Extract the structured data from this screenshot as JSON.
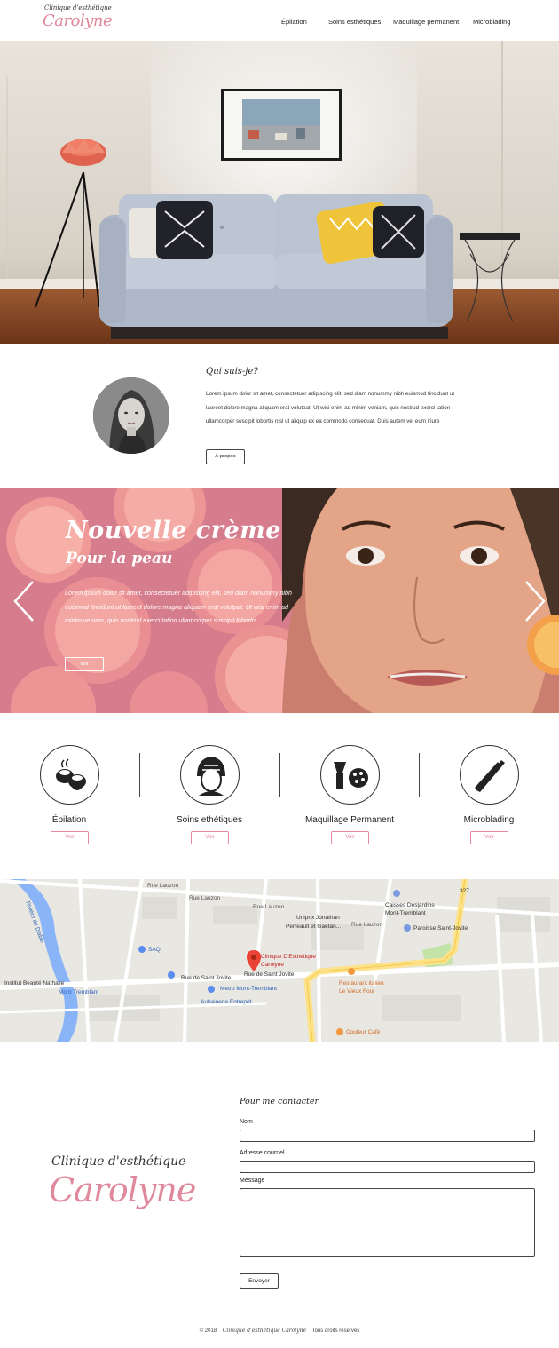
{
  "logo": {
    "line1": "Clinique d'esthétique",
    "line2": "Carolyne"
  },
  "nav": {
    "items": [
      {
        "label": "Épilation"
      },
      {
        "label": "Soins esthétiques"
      },
      {
        "label": "Maquillage permanent"
      },
      {
        "label": "Microblading"
      }
    ]
  },
  "about": {
    "title": "Qui suis-je?",
    "text": "Lorem ipsum dolor sit amet, consectetuer adipiscing elit, sed diam nonummy nibh euismod tincidunt ut laoreet dolore magna aliquam erat volutpat. Ut wisi enim ad minim veniam, quis nostrud exerci tation ullamcorper suscipit lobortis nisl ut aliquip ex ea commodo consequat. Duis autem vel eum iriure",
    "button": "À propos"
  },
  "promo": {
    "title": "Nouvelle crème",
    "subtitle": "Pour la peau",
    "text": "Lorem ipsum dolor sit amet, consectetuer adipiscing elit, sed diam nonummy nibh euismod tincidunt ut laoreet dolore magna aliquam erat volutpat. Ut wisi enim ad minim veniam, quis nostrud exerci tation ullamcorper suscipit lobortis",
    "button": "Voir"
  },
  "services": [
    {
      "name": "Épilation",
      "button": "Voir",
      "icon": "hot-stones-icon"
    },
    {
      "name": "Soins ethétiques",
      "button": "Voir",
      "icon": "face-towel-icon"
    },
    {
      "name": "Maquillage Permanent",
      "button": "Voir",
      "icon": "makeup-brush-palette-icon"
    },
    {
      "name": "Microblading",
      "button": "Voir",
      "icon": "tweezers-icon"
    }
  ],
  "map": {
    "labels": {
      "clinic_line1": "Clinique D'Esthétique",
      "clinic_line2": "Carolyne",
      "rue_saint_jovite": "Rue de Saint Jovite",
      "rue_saint_jovite_2": "Rue de Saint Jovite",
      "rue_lauzon_1": "Rue Lauzon",
      "rue_lauzon_2": "Rue Lauzon",
      "rue_lauzon_3": "Rue Lauzon",
      "rue_lauzon_4": "Rue Lauzon",
      "uniprix_1": "Uniprix Jonathan",
      "uniprix_2": "Perreault et Gaëtan...",
      "caisses_1": "Caisses Desjardins",
      "caisses_2": "Mont-Tremblant",
      "paroisse": "Paroisse Saint-Jovite",
      "saq": "SAQ",
      "institut": "Institut Beauté Nathalie",
      "mont_tremblant": "Mont Tremblant",
      "metro": "Metro Mont-Tremblant",
      "aubainerie": "Aubainerie Entrepôt",
      "restaurant_1": "Restaurant italien",
      "restaurant_2": "Le Vieux Four",
      "couleur_cafe": "Couleur Café",
      "riviere": "Rivière du Diable",
      "route_327": "327"
    }
  },
  "contact": {
    "title": "Pour me contacter",
    "name_label": "Nom",
    "email_label": "Adresse courriel",
    "message_label": "Message",
    "name_value": "",
    "email_value": "",
    "message_value": "",
    "button": "Envoyer"
  },
  "footer": {
    "copyright": "© 2018",
    "brand": "Clinique d'esthétique Carolyne",
    "rights": "Tous droits réservés"
  },
  "colors": {
    "accent": "#e7879b",
    "brand_pink": "#e0889c",
    "promo_bg": "#d87c8c"
  }
}
